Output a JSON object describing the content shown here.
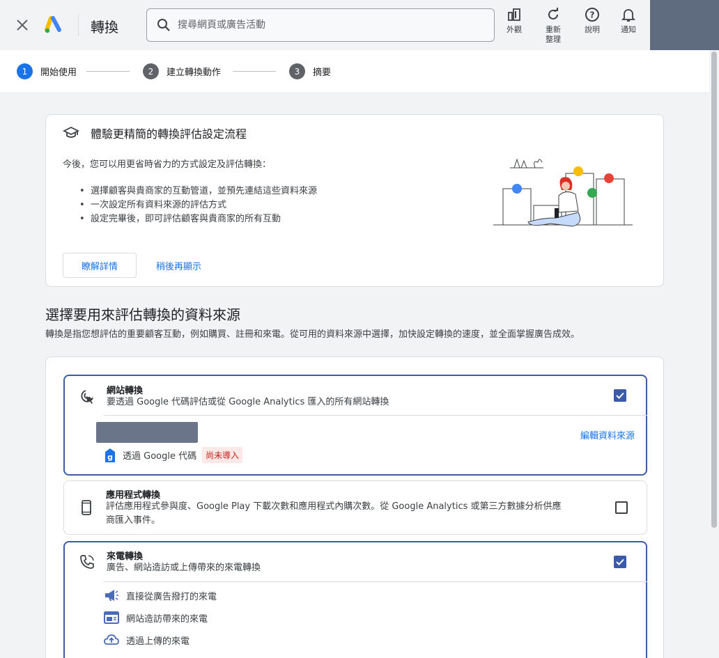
{
  "header": {
    "title": "轉換",
    "search_placeholder": "搜尋網頁或廣告活動",
    "buttons": [
      {
        "label": "外觀",
        "icon": "appearance-icon"
      },
      {
        "label": "重新\n整理",
        "icon": "refresh-icon"
      },
      {
        "label": "說明",
        "icon": "help-icon"
      },
      {
        "label": "通知",
        "icon": "bell-icon"
      }
    ]
  },
  "stepper": {
    "steps": [
      {
        "num": "1",
        "label": "開始使用"
      },
      {
        "num": "2",
        "label": "建立轉換動作"
      },
      {
        "num": "3",
        "label": "摘要"
      }
    ]
  },
  "promo": {
    "title": "體驗更精簡的轉換評估設定流程",
    "intro": "今後，您可以用更省時省力的方式設定及評估轉換：",
    "bullets": [
      "選擇顧客與貴商家的互動管道，並預先連結這些資料來源",
      "一次設定所有資料來源的評估方式",
      "設定完畢後，即可評估顧客與貴商家的所有互動"
    ],
    "learn_more": "瞭解詳情",
    "remind_later": "稍後再顯示"
  },
  "section": {
    "title": "選擇要用來評估轉換的資料來源",
    "desc": "轉換是指您想評估的重要顧客互動，例如購買、註冊和來電。從可用的資料來源中選擇，加快設定轉換的速度，並全面掌握廣告成效。"
  },
  "sources": {
    "website": {
      "title": "網站轉換",
      "desc": "要透過 Google 代碼評估或從 Google Analytics 匯入的所有網站轉換",
      "checked": true,
      "edit_link": "編輯資料來源",
      "gtag_label": "透過 Google 代碼",
      "gtag_status": "尚未導入"
    },
    "app": {
      "title": "應用程式轉換",
      "desc_line1": "評估應用程式參與度、Google Play 下載次數和應用程式內購次數。從 Google Analytics 或第三方數據分析供應",
      "desc_line2": "商匯入事件。",
      "checked": false
    },
    "calls": {
      "title": "來電轉換",
      "desc": "廣告、網站造訪或上傳帶來的來電轉換",
      "checked": true,
      "subs": [
        {
          "label": "直接從廣告撥打的來電",
          "icon": "megaphone-icon"
        },
        {
          "label": "網站造訪帶來的來電",
          "icon": "website-icon"
        },
        {
          "label": "透過上傳的來電",
          "icon": "cloud-upload-icon"
        }
      ]
    }
  },
  "colors": {
    "accent": "#1a73e8",
    "selected_border": "#3b5ba9",
    "warning_bg": "#fce8e6",
    "warning_text": "#c5221f"
  }
}
